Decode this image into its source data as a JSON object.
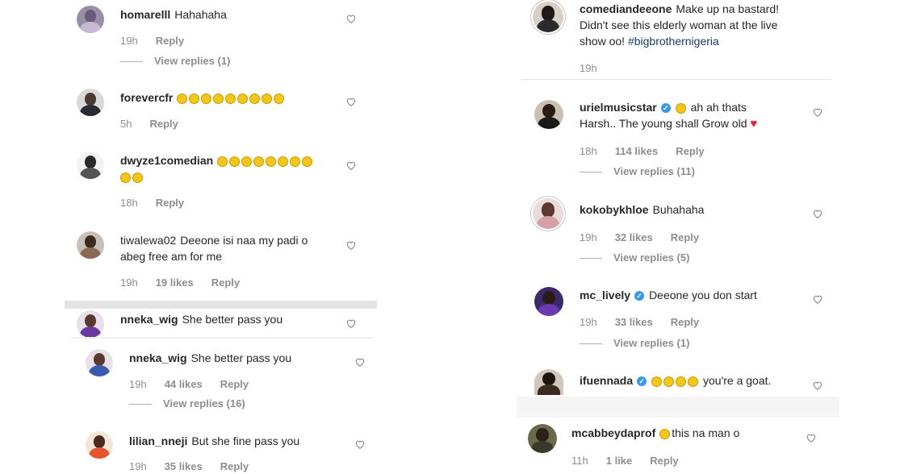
{
  "left": {
    "c1": {
      "user": "homarelll",
      "text": "Hahahaha",
      "time": "19h",
      "reply": "Reply",
      "view": "View replies (1)"
    },
    "c2": {
      "user": "forevercfr",
      "time": "5h",
      "reply": "Reply"
    },
    "c3": {
      "user": "dwyze1comedian",
      "time": "18h",
      "reply": "Reply"
    },
    "c4": {
      "user": "tiwalewa02",
      "text1": "Deeone isi naa my padi o",
      "text2": "abeg free am for me",
      "time": "19h",
      "likes": "19 likes",
      "reply": "Reply"
    },
    "c5": {
      "user": "nneka_wig",
      "text": "She better pass you"
    },
    "c6": {
      "user": "nneka_wig",
      "text": "She better pass you",
      "time": "19h",
      "likes": "44 likes",
      "reply": "Reply",
      "view": "View replies (16)"
    },
    "c7": {
      "user": "lilian_nneji",
      "text": "But she fine pass you",
      "time": "19h",
      "likes": "35 likes",
      "reply": "Reply"
    }
  },
  "right": {
    "c1": {
      "user": "comediandeeone",
      "text1": "Make up na bastard!",
      "text2": "Didn't see this elderly woman at the live",
      "text3": "show oo!",
      "hashtag": "#bigbrothernigeria",
      "time": "19h"
    },
    "c2": {
      "user": "urielmusicstar",
      "text1": "ah ah thats",
      "text2": "Harsh.. The young shall Grow old",
      "time": "18h",
      "likes": "114 likes",
      "reply": "Reply",
      "view": "View replies (11)"
    },
    "c3": {
      "user": "kokobykhloe",
      "text": "Buhahaha",
      "time": "19h",
      "likes": "32 likes",
      "reply": "Reply",
      "view": "View replies (5)"
    },
    "c4": {
      "user": "mc_lively",
      "text": "Deeone you don start",
      "time": "19h",
      "likes": "33 likes",
      "reply": "Reply",
      "view": "View replies (1)"
    },
    "c5": {
      "user": "ifuennada",
      "text": "you're a goat."
    },
    "c6": {
      "user": "mcabbeydaprof",
      "text": "this na man o",
      "time": "11h",
      "likes": "1 like",
      "reply": "Reply"
    }
  },
  "icons": {
    "heart": "heart-outline-icon",
    "verified": "verified-badge-icon",
    "emoji": "laughing-emoji-icon"
  }
}
